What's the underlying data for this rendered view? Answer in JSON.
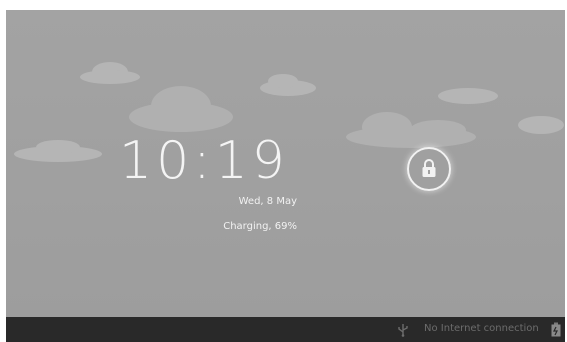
{
  "lockscreen": {
    "time": "10:19",
    "date": "Wed, 8 May",
    "charging": "Charging, 69%"
  },
  "statusbar": {
    "usb_icon": "usb-icon",
    "connection_text": "No Internet connection",
    "battery_icon": "battery-charging-icon",
    "battery_level": 0.69
  },
  "icons": {
    "unlock": "lock-icon"
  },
  "colors": {
    "wallpaper": "#a1a1a1",
    "statusbar": "#292929",
    "text": "#f2f2f2"
  }
}
